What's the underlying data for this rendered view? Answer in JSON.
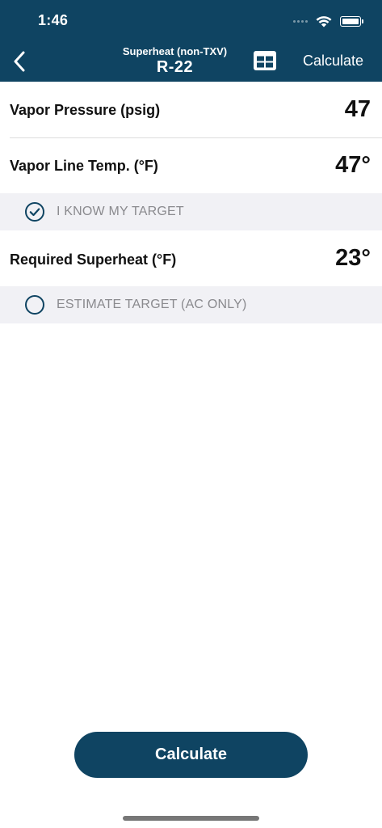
{
  "status_bar": {
    "time": "1:46",
    "icons": [
      "cellular-icon",
      "wifi-icon",
      "battery-icon"
    ]
  },
  "nav": {
    "back_icon": "chevron-left-icon",
    "subtitle": "Superheat (non-TXV)",
    "title": "R-22",
    "table_icon": "table-grid-icon",
    "calculate_label": "Calculate"
  },
  "fields": {
    "vapor_pressure": {
      "label": "Vapor Pressure (psig)",
      "value": "47"
    },
    "vapor_line_temp": {
      "label": "Vapor Line Temp. (°F)",
      "value": "47°"
    },
    "required_superheat": {
      "label": "Required Superheat (°F)",
      "value": "23°"
    }
  },
  "options": {
    "know_target": {
      "label": "I KNOW MY TARGET",
      "selected": true,
      "icon": "check-circle-icon"
    },
    "estimate_target": {
      "label": "ESTIMATE TARGET (AC ONLY)",
      "selected": false,
      "icon": "empty-circle-icon"
    }
  },
  "footer": {
    "calculate_button_label": "Calculate"
  },
  "colors": {
    "brand": "#0f4462",
    "option_bg": "#f1f1f5",
    "option_text": "#8a8a8e"
  }
}
